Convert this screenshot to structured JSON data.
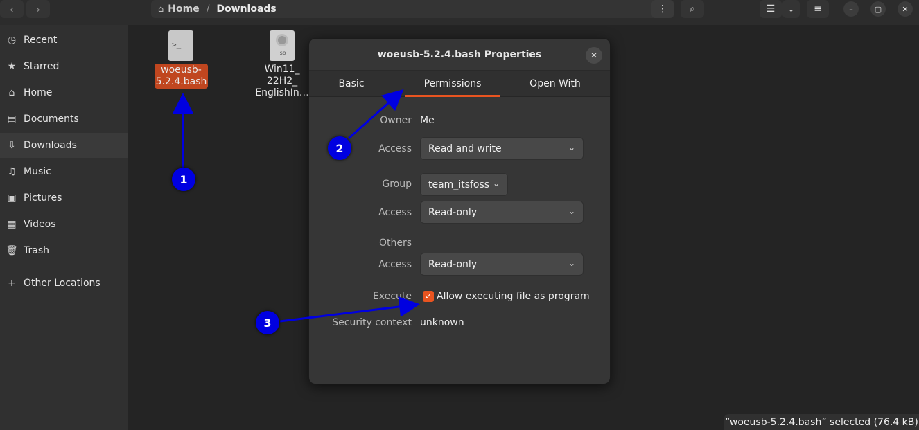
{
  "toolbar": {
    "back_icon": "chevron-left-icon",
    "forward_icon": "chevron-right-icon",
    "breadcrumb": [
      "Home",
      "/",
      "Downloads"
    ]
  },
  "sidebar": {
    "items": [
      {
        "label": "Recent",
        "icon": "clock-icon"
      },
      {
        "label": "Starred",
        "icon": "star-icon"
      },
      {
        "label": "Home",
        "icon": "home-icon"
      },
      {
        "label": "Documents",
        "icon": "document-icon"
      },
      {
        "label": "Downloads",
        "icon": "download-icon"
      },
      {
        "label": "Music",
        "icon": "music-icon"
      },
      {
        "label": "Pictures",
        "icon": "picture-icon"
      },
      {
        "label": "Videos",
        "icon": "video-icon"
      },
      {
        "label": "Trash",
        "icon": "trash-icon"
      },
      {
        "label": "Other Locations",
        "icon": "plus-icon"
      }
    ]
  },
  "files": [
    {
      "name_line1": "woeusb-",
      "name_line2": "5.2.4.bash",
      "icon": "script-file-icon",
      "icon_text": ">_"
    },
    {
      "name_line1": "Win11_",
      "name_line2": "22H2_",
      "name_line3": "EnglishIn…",
      "icon": "iso-file-icon",
      "icon_text": "iso"
    }
  ],
  "dialog": {
    "title": "woeusb-5.2.4.bash Properties",
    "tabs": [
      "Basic",
      "Permissions",
      "Open With"
    ],
    "owner_label": "Owner",
    "owner_value": "Me",
    "access_label": "Access",
    "owner_access": "Read and write",
    "group_label": "Group",
    "group_value": "team_itsfoss",
    "group_access": "Read-only",
    "others_label": "Others",
    "others_access": "Read-only",
    "execute_label": "Execute",
    "execute_checkbox": "Allow executing file as program",
    "security_label": "Security context",
    "security_value": "unknown"
  },
  "status_bar": "“woeusb-5.2.4.bash” selected  (76.4 kB)",
  "annotations": [
    "1",
    "2",
    "3"
  ],
  "colors": {
    "accent": "#e95420",
    "annotation": "#0000e0"
  }
}
